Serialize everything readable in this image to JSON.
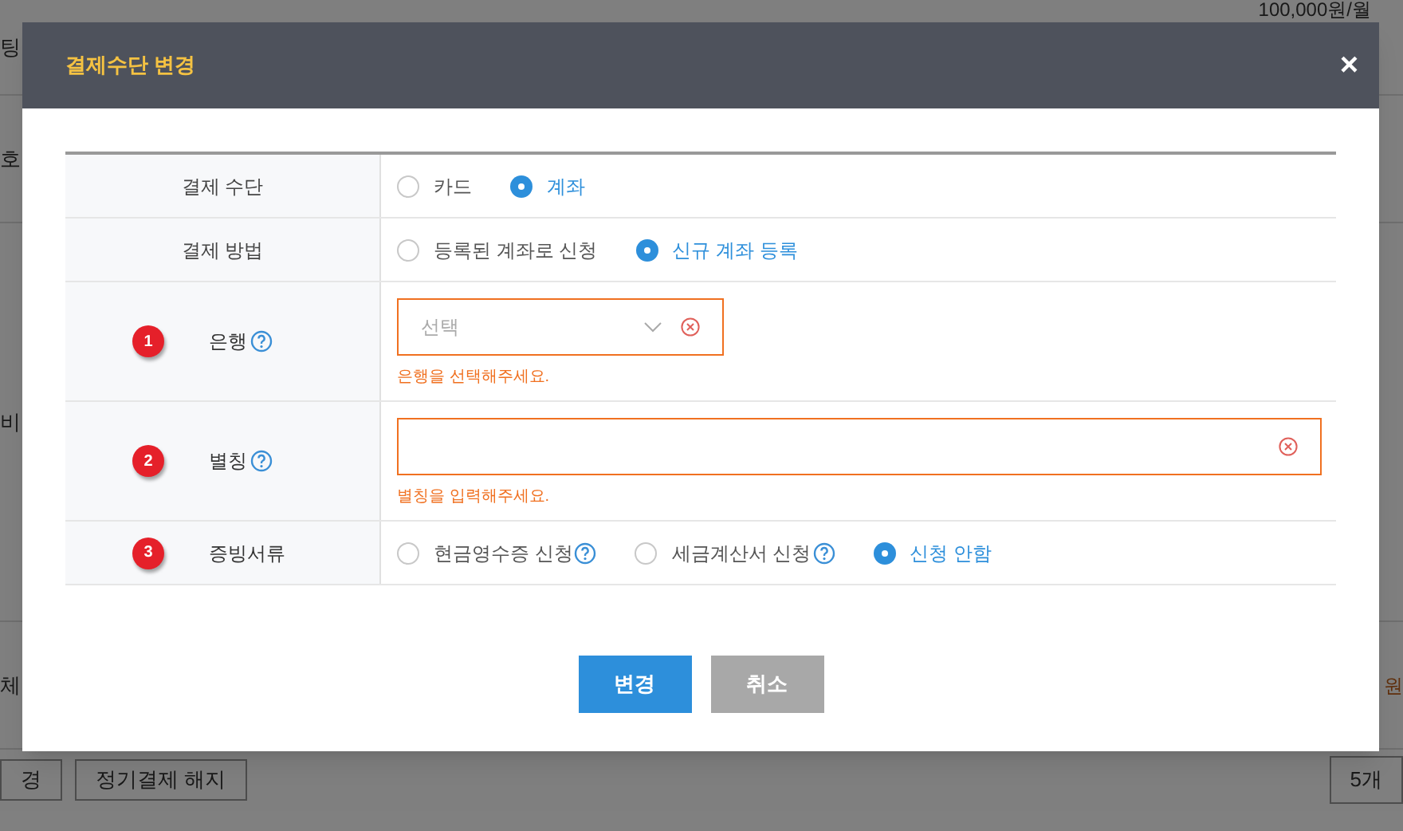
{
  "background": {
    "rows": [
      {
        "left": "팅",
        "right": "100,000원/월"
      },
      {
        "left": "호",
        "right": ""
      },
      {
        "left": "비",
        "right": ""
      },
      {
        "left": "체",
        "right": "원"
      }
    ],
    "buttons": [
      "경",
      "정기결제 해지"
    ],
    "count_button": "5개"
  },
  "dialog": {
    "title": "결제수단 변경",
    "close": "×",
    "rows": [
      {
        "kind": "radio",
        "label": "결제 수단",
        "options": [
          {
            "label": "카드",
            "selected": false,
            "help": false
          },
          {
            "label": "계좌",
            "selected": true,
            "help": false
          }
        ]
      },
      {
        "kind": "radio",
        "label": "결제 방법",
        "options": [
          {
            "label": "등록된 계좌로 신청",
            "selected": false,
            "help": false
          },
          {
            "label": "신규 계좌 등록",
            "selected": true,
            "help": false
          }
        ]
      },
      {
        "kind": "select",
        "number": "1",
        "label": "은행",
        "help": true,
        "placeholder": "선택",
        "error": "은행을 선택해주세요."
      },
      {
        "kind": "text",
        "number": "2",
        "label": "별칭",
        "help": true,
        "error": "별칭을 입력해주세요."
      },
      {
        "kind": "radio",
        "number": "3",
        "label": "증빙서류",
        "options": [
          {
            "label": "현금영수증 신청",
            "selected": false,
            "help": true
          },
          {
            "label": "세금계산서 신청",
            "selected": false,
            "help": true
          },
          {
            "label": "신청 안함",
            "selected": true,
            "help": false
          }
        ]
      }
    ],
    "buttons": [
      {
        "label": "변경",
        "kind": "primary"
      },
      {
        "label": "취소",
        "kind": "secondary"
      }
    ]
  }
}
